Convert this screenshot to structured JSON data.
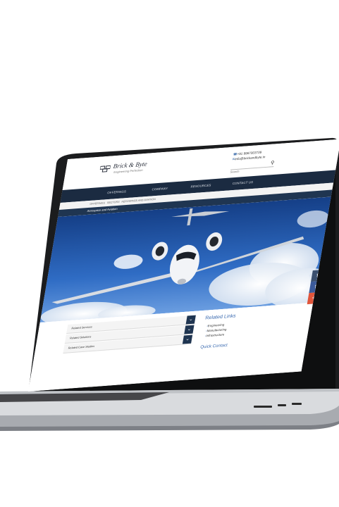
{
  "logo": {
    "title": "Brick & Byte",
    "subtitle": "Engineering Perfection"
  },
  "contact": {
    "phone": "+91 9967003739",
    "email": "info@brickandbyte.in"
  },
  "search": {
    "placeholder": "Search"
  },
  "nav": {
    "items": [
      "OFFERINGS",
      "COMPANY",
      "RESOURCES",
      "CONTACT US"
    ]
  },
  "breadcrumb": [
    "OFFERINGS",
    "SECTORS",
    "AEROSPACE AND AVIATION"
  ],
  "page_title": "Aerospace and Aviation",
  "accordion": [
    "Related Services",
    "Related Solutions",
    "Related Case Studies"
  ],
  "related_links": {
    "title": "Related Links",
    "items": [
      "Engineering",
      "Manufacturing",
      "Infrastructure"
    ]
  },
  "quick_contact": "Quick Contact",
  "social": [
    {
      "icon": "tumblr-icon",
      "glyph": "t",
      "color": "#3a4f6e"
    },
    {
      "icon": "facebook-icon",
      "glyph": "f",
      "color": "#3b5a9a"
    },
    {
      "icon": "google-plus-icon",
      "glyph": "+",
      "color": "#e0553b"
    }
  ]
}
